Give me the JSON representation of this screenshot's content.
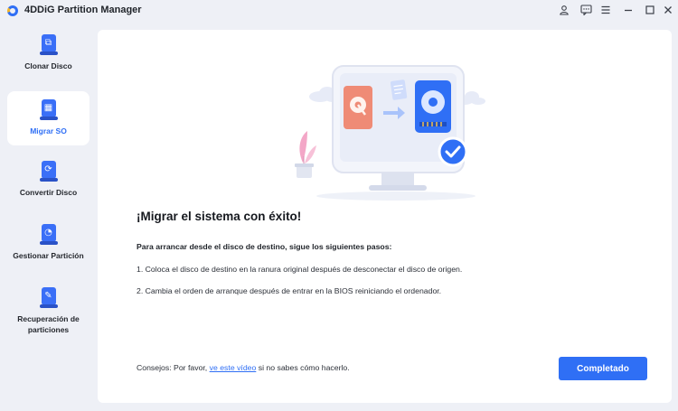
{
  "app": {
    "title": "4DDiG Partition Manager"
  },
  "window_controls": {
    "user": "user-icon",
    "feedback": "feedback-icon",
    "menu": "menu-icon",
    "minimize": "minimize-icon",
    "maximize": "maximize-icon",
    "close": "close-icon"
  },
  "sidebar": {
    "items": [
      {
        "label": "Clonar Disco",
        "icon": "clone-disk-icon",
        "active": false
      },
      {
        "label": "Migrar SO",
        "icon": "migrate-os-icon",
        "active": true
      },
      {
        "label": "Convertir Disco",
        "icon": "convert-disk-icon",
        "active": false
      },
      {
        "label": "Gestionar Partición",
        "icon": "manage-partition-icon",
        "active": false
      },
      {
        "label": "Recuperación de particiones",
        "icon": "partition-recovery-icon",
        "active": false
      }
    ]
  },
  "main": {
    "heading": "¡Migrar el sistema con éxito!",
    "steps_title": "Para arrancar desde el disco de destino, sigue los siguientes pasos:",
    "steps": [
      "1. Coloca el disco de destino en la ranura original después de desconectar el disco de origen.",
      "2. Cambia el orden de arranque después de entrar en la BIOS reiniciando el ordenador."
    ],
    "tips": {
      "prefix": "Consejos: Por favor, ",
      "link": "ve este vídeo",
      "suffix": " si no sabes cómo hacerlo."
    },
    "done_button": "Completado"
  },
  "colors": {
    "accent": "#2f6ff5",
    "background": "#eef0f6",
    "panel": "#ffffff"
  }
}
